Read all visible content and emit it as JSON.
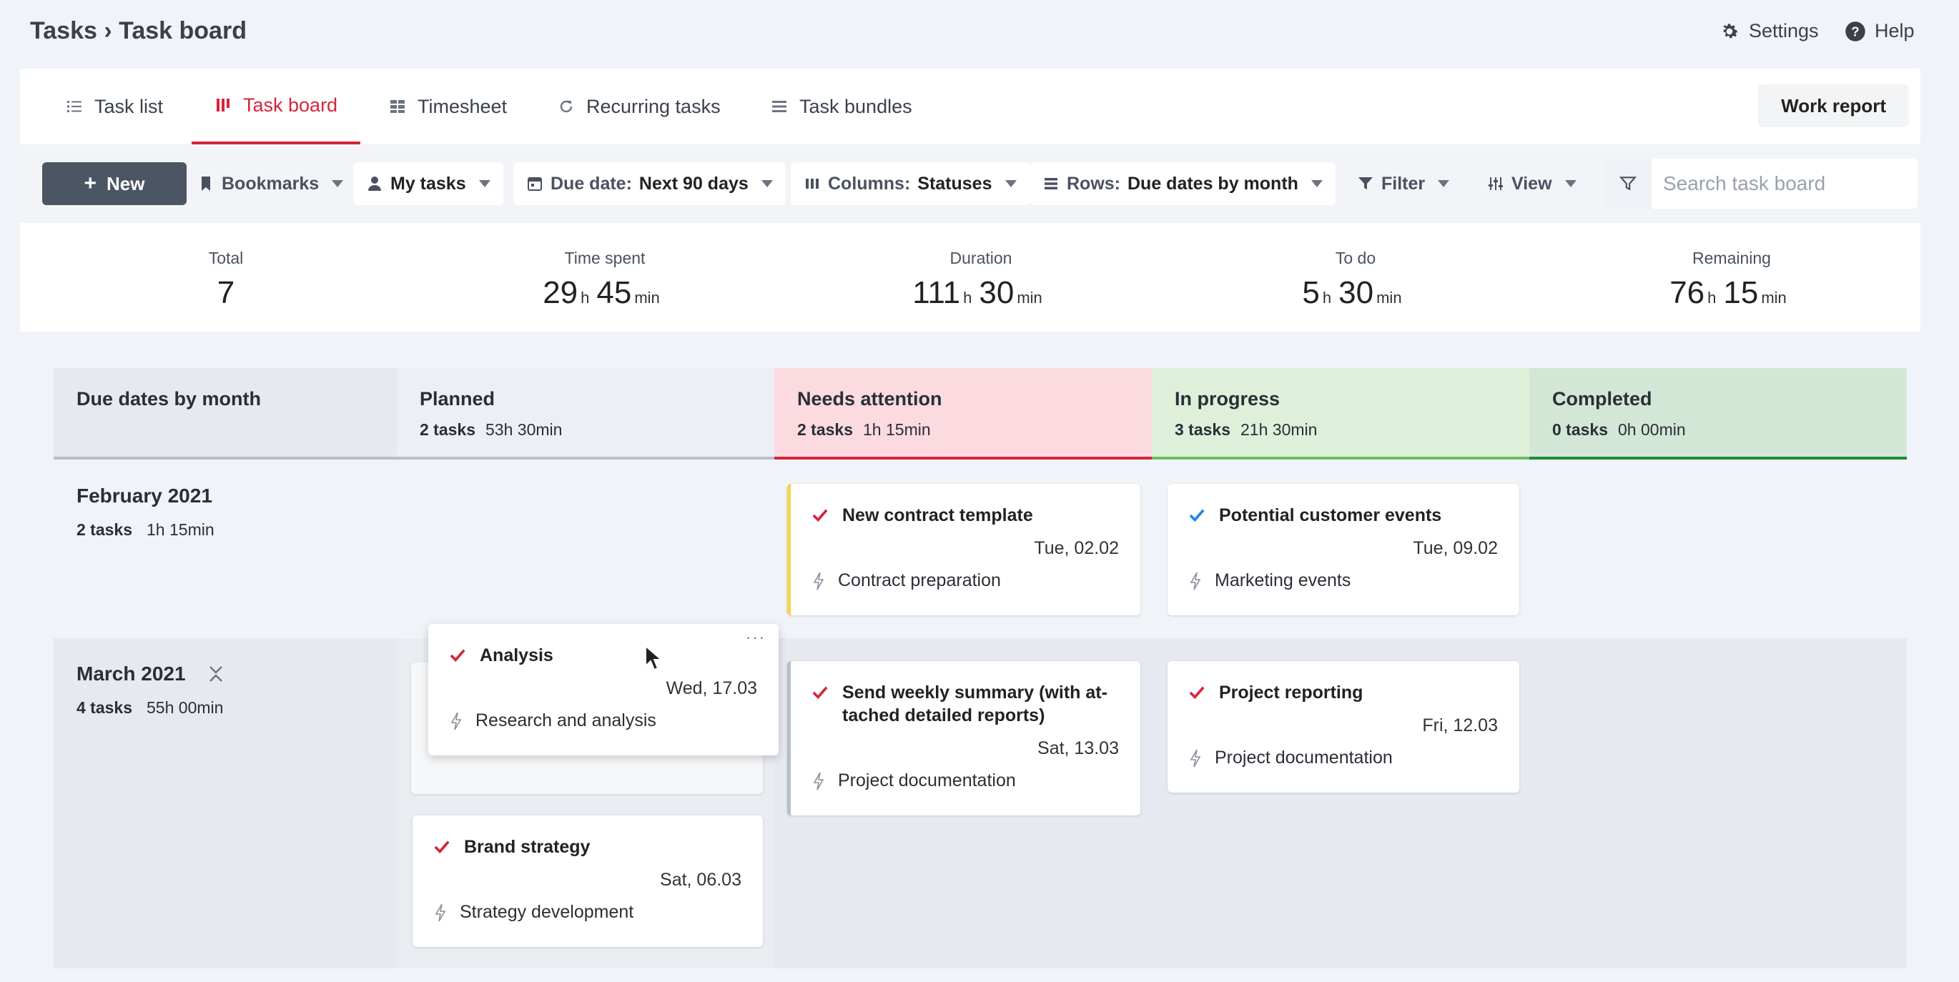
{
  "header": {
    "title": "Tasks › Task board",
    "settings_label": "Settings",
    "help_label": "Help"
  },
  "tabs": [
    {
      "label": "Task list",
      "icon": "list-icon",
      "active": false
    },
    {
      "label": "Task board",
      "icon": "board-icon",
      "active": true
    },
    {
      "label": "Timesheet",
      "icon": "grid-icon",
      "active": false
    },
    {
      "label": "Recurring tasks",
      "icon": "refresh-icon",
      "active": false
    },
    {
      "label": "Task bundles",
      "icon": "bundle-icon",
      "active": false
    }
  ],
  "work_report_label": "Work report",
  "toolbar": {
    "new_label": "New",
    "bookmarks_label": "Bookmarks",
    "mytasks_label": "My tasks",
    "duedate_prefix": "Due date:",
    "duedate_value": "Next 90 days",
    "columns_prefix": "Columns:",
    "columns_value": "Statuses",
    "rows_prefix": "Rows:",
    "rows_value": "Due dates by month",
    "filter_label": "Filter",
    "view_label": "View",
    "search_placeholder": "Search task board"
  },
  "stats": {
    "total": {
      "label": "Total",
      "value": "7"
    },
    "time_spent": {
      "label": "Time spent",
      "h": "29",
      "m": "45"
    },
    "duration": {
      "label": "Duration",
      "h": "111",
      "m": "30"
    },
    "todo": {
      "label": "To do",
      "h": "5",
      "m": "30"
    },
    "remaining": {
      "label": "Remaining",
      "h": "76",
      "m": "15"
    },
    "unit_h": "h",
    "unit_min": "min"
  },
  "board": {
    "row_header_title": "Due dates by month",
    "columns": [
      {
        "name": "Planned",
        "tasks": "2 tasks",
        "time": "53h 30min",
        "bg": "#eceff4",
        "border": "#b6bfcc"
      },
      {
        "name": "Needs attention",
        "tasks": "2 tasks",
        "time": "1h 15min",
        "bg": "#fbdbe0",
        "border": "#d6243c"
      },
      {
        "name": "In progress",
        "tasks": "3 tasks",
        "time": "21h 30min",
        "bg": "#def0da",
        "border": "#6cbf5c"
      },
      {
        "name": "Completed",
        "tasks": "0 tasks",
        "time": "0h 00min",
        "bg": "#d3e7d7",
        "border": "#1f8a3a"
      }
    ],
    "rows": [
      {
        "title": "February 2021",
        "tasks": "2 tasks",
        "time": "1h 15min"
      },
      {
        "title": "March 2021",
        "tasks": "4 tasks",
        "time": "55h 00min"
      }
    ],
    "cards": {
      "new_contract": {
        "title": "New contract template",
        "date": "Tue, 02.02",
        "project": "Contract preparation",
        "check_color": "#d6243c",
        "accent": "#f5d44a"
      },
      "potential_events": {
        "title": "Potential customer events",
        "date": "Tue, 09.02",
        "project": "Marketing events",
        "check_color": "#1e88e5"
      },
      "analysis": {
        "title": "Analysis",
        "date": "Wed, 17.03",
        "project": "Research and analysis",
        "check_color": "#d6243c"
      },
      "weekly_summary": {
        "title": "Send weekly summary (with at-tached detailed reports)",
        "date": "Sat, 13.03",
        "project": "Project documentation",
        "check_color": "#d6243c",
        "accent": "#b9bec6"
      },
      "project_reporting": {
        "title": "Project reporting",
        "date": "Fri, 12.03",
        "project": "Project documentation",
        "check_color": "#d6243c"
      },
      "brand_strategy": {
        "title": "Brand strategy",
        "date": "Sat, 06.03",
        "project": "Strategy development",
        "check_color": "#d6243c"
      }
    }
  }
}
